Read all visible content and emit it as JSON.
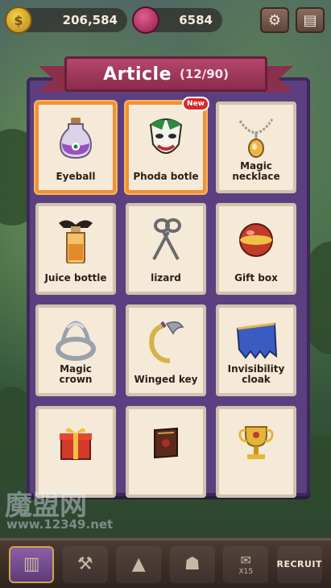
{
  "topbar": {
    "gold": "206,584",
    "gems": "6584",
    "settings_icon": "gear-icon",
    "book_icon": "book-icon"
  },
  "panel": {
    "title": "Article",
    "count": "(12/90)"
  },
  "items": [
    {
      "label": "Eyeball",
      "icon": "potion-bottle-icon",
      "selected": true,
      "new": false
    },
    {
      "label": "Phoda botle",
      "icon": "jester-mask-icon",
      "selected": true,
      "new": true,
      "badge": "New"
    },
    {
      "label": "Magic necklace",
      "icon": "necklace-icon",
      "selected": false,
      "new": false
    },
    {
      "label": "Juice bottle",
      "icon": "juice-bottle-icon",
      "selected": false,
      "new": false
    },
    {
      "label": "lizard",
      "icon": "scissors-icon",
      "selected": false,
      "new": false
    },
    {
      "label": "Gift box",
      "icon": "gift-box-icon",
      "selected": false,
      "new": false
    },
    {
      "label": "Magic crown",
      "icon": "crown-icon",
      "selected": false,
      "new": false
    },
    {
      "label": "Winged key",
      "icon": "winged-key-icon",
      "selected": false,
      "new": false
    },
    {
      "label": "Invisibility cloak",
      "icon": "cloak-icon",
      "selected": false,
      "new": false
    },
    {
      "label": "",
      "icon": "present-icon",
      "selected": false,
      "new": false
    },
    {
      "label": "",
      "icon": "spellbook-icon",
      "selected": false,
      "new": false
    },
    {
      "label": "",
      "icon": "trophy-icon",
      "selected": false,
      "new": false
    }
  ],
  "dock": {
    "recruit_label": "RECRUIT",
    "x15": "X15"
  },
  "watermark": {
    "cn": "魔盟网",
    "url": "www.12349.net"
  },
  "colors": {
    "panel": "#5b3f80",
    "ribbon": "#b4476c",
    "card": "#f5ead7",
    "selected_border": "#f0913a"
  }
}
